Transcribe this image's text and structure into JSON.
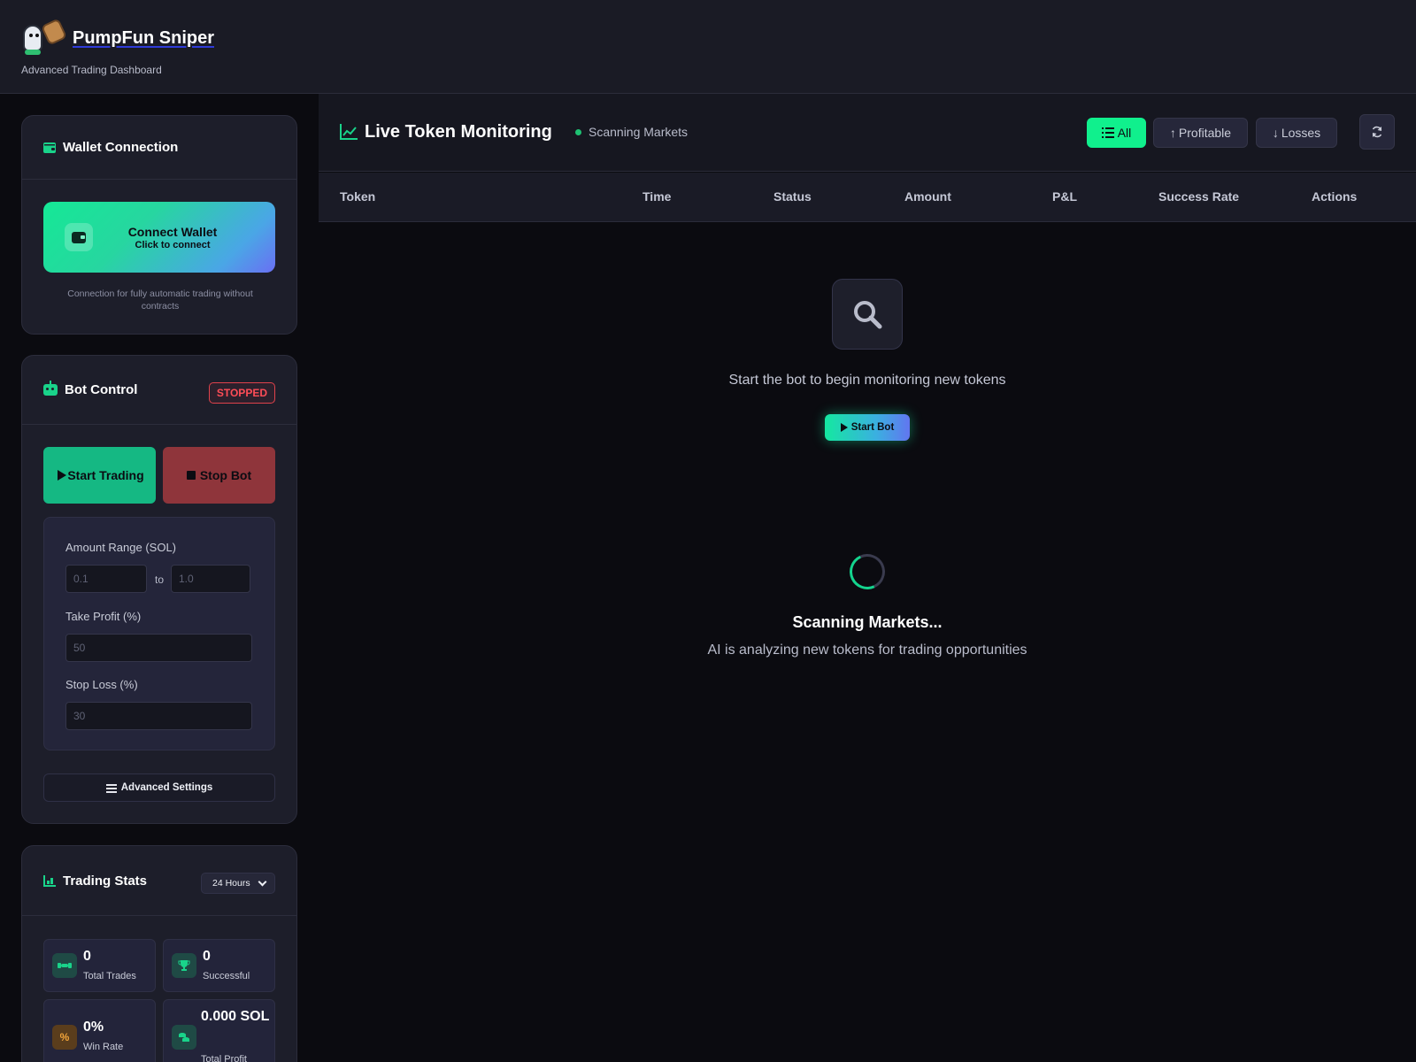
{
  "app": {
    "title": "PumpFun Sniper",
    "subtitle": "Advanced Trading Dashboard"
  },
  "wallet": {
    "title": "Wallet Connection",
    "button_label": "Connect Wallet",
    "button_sub": "Click to connect",
    "note": "Connection for fully automatic trading without contracts"
  },
  "bot": {
    "title": "Bot Control",
    "status": "STOPPED",
    "start_label": "Start Trading",
    "stop_label": "Stop Bot",
    "amount_label": "Amount Range (SOL)",
    "amount_min_placeholder": "0.1",
    "amount_to": "to",
    "amount_max_placeholder": "1.0",
    "take_profit_label": "Take Profit (%)",
    "take_profit_placeholder": "50",
    "stop_loss_label": "Stop Loss (%)",
    "stop_loss_placeholder": "30",
    "advanced_label": "Advanced Settings"
  },
  "stats": {
    "title": "Trading Stats",
    "range": "24 Hours",
    "items": [
      {
        "value": "0",
        "label": "Total Trades",
        "icon": "handshake-icon"
      },
      {
        "value": "0",
        "label": "Successful",
        "icon": "trophy-icon"
      },
      {
        "value": "0%",
        "label": "Win Rate",
        "icon": "percent-icon"
      },
      {
        "value": "0.000 SOL",
        "label": "Total Profit",
        "icon": "coins-icon"
      }
    ]
  },
  "monitor": {
    "title": "Live Token Monitoring",
    "status": "Scanning Markets",
    "filters": [
      "All",
      "Profitable",
      "Losses"
    ],
    "active_filter": "All",
    "columns": [
      "Token",
      "Time",
      "Status",
      "Amount",
      "P&L",
      "Success Rate",
      "Actions"
    ],
    "empty_text": "Start the bot to begin monitoring new tokens",
    "empty_button": "Start Bot",
    "scan_title": "Scanning Markets...",
    "scan_sub": "AI is analyzing new tokens for trading opportunities"
  },
  "colors": {
    "accent": "#10f08d",
    "danger": "#ff4d57",
    "background": "#0b0b10",
    "panel": "#1d1e2a"
  }
}
